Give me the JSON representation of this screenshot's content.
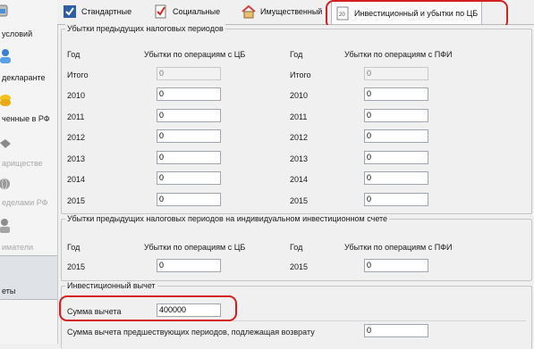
{
  "sidebar": {
    "items": [
      {
        "label": "условий"
      },
      {
        "label": "декларанте"
      },
      {
        "label": "ченные в РФ"
      },
      {
        "label": "ариществе"
      },
      {
        "label": "еделами РФ"
      },
      {
        "label": "иматели"
      },
      {
        "label": "еты"
      }
    ]
  },
  "tabs": [
    {
      "label": "Стандартные",
      "icon": "check-icon"
    },
    {
      "label": "Социальные",
      "icon": "document-check-icon"
    },
    {
      "label": "Имущественный",
      "icon": "house-icon"
    },
    {
      "label": "Инвестиционный и убытки по ЦБ",
      "icon": "investment-doc-icon"
    }
  ],
  "prior_losses": {
    "title": "Убытки предыдущих налоговых периодов",
    "left": {
      "year_header": "Год",
      "value_header": "Убытки по операциям с ЦБ",
      "rows": [
        {
          "label": "Итого",
          "value": "0",
          "readonly": true
        },
        {
          "label": "2010",
          "value": "0"
        },
        {
          "label": "2011",
          "value": "0"
        },
        {
          "label": "2012",
          "value": "0"
        },
        {
          "label": "2013",
          "value": "0"
        },
        {
          "label": "2014",
          "value": "0"
        },
        {
          "label": "2015",
          "value": "0"
        }
      ]
    },
    "right": {
      "year_header": "Год",
      "value_header": "Убытки по операциям с ПФИ",
      "rows": [
        {
          "label": "Итого",
          "value": "0",
          "readonly": true
        },
        {
          "label": "2010",
          "value": "0"
        },
        {
          "label": "2011",
          "value": "0"
        },
        {
          "label": "2012",
          "value": "0"
        },
        {
          "label": "2013",
          "value": "0"
        },
        {
          "label": "2014",
          "value": "0"
        },
        {
          "label": "2015",
          "value": "0"
        }
      ]
    }
  },
  "iis_losses": {
    "title": "Убытки предыдущих налоговых периодов на индивидуальном инвестиционном счете",
    "left": {
      "year_header": "Год",
      "value_header": "Убытки по операциям с ЦБ",
      "year": "2015",
      "value": "0"
    },
    "right": {
      "year_header": "Год",
      "value_header": "Убытки по операциям с ПФИ",
      "year": "2015",
      "value": "0"
    }
  },
  "investment_deduction": {
    "title": "Инвестиционный вычет",
    "amount_label": "Сумма вычета",
    "amount_value": "400000",
    "previous_label": "Сумма вычета предшествующих периодов, подлежащая возврату",
    "previous_value": "0"
  },
  "colors": {
    "highlight": "#d42020"
  }
}
